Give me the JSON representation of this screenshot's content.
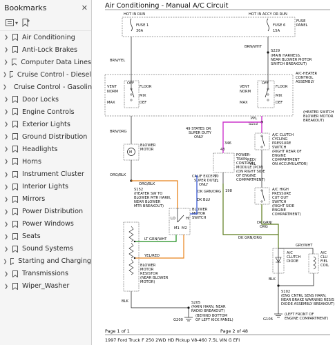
{
  "sidebar": {
    "title": "Bookmarks",
    "close": "✕",
    "bookmarks": [
      "Air Conditioning",
      "Anti-Lock Brakes",
      "Computer Data Lines",
      "Cruise Control - Diesel",
      "Cruise Control - Gasoline",
      "Door Locks",
      "Engine Controls",
      "Exterior Lights",
      "Ground Distribution",
      "Headlights",
      "Horns",
      "Instrument Cluster",
      "Interior Lights",
      "Mirrors",
      "Power Distribution",
      "Power Windows",
      "Seats",
      "Sound Systems",
      "Starting and Charging",
      "Transmissions",
      "Wiper_Washer"
    ]
  },
  "diagram": {
    "title": "Air Conditioning - Manual A/C Circuit",
    "hot_run": "HOT IN RUN",
    "hot_accy": "HOT IN ACCY OR RUN",
    "fuse1": "FUSE 1",
    "fuse1_amp": "30A",
    "fuse6": "FUSE 6",
    "fuse6_amp": "15A",
    "fuse_panel_1": "FUSE",
    "fuse_panel_2": "PANEL",
    "w_brn_yel": "BRN/YEL",
    "w_brn_wht": "BRN/WHT",
    "s229": "S229",
    "s229_n1": "(MAIN HARNESS,",
    "s229_n2": "NEAR BLOWER MOTOR",
    "s229_n3": "SWITCH BREAKOUT)",
    "ach1": "A/C-HEATER",
    "ach2": "CONTROL",
    "ach3": "ASSEMBLY",
    "vent": "VENT",
    "norm": "NORM",
    "max": "MAX",
    "off": "OFF",
    "floor": "FLOOR",
    "mix": "MIX",
    "def": "DEF",
    "ppl": "PPL",
    "s153": "S153",
    "hs1": "(HEATER SWITCH",
    "hs2": "BLOWER MOTOR",
    "hs3": "BREAKOUT)",
    "w_brn_org": "BRN/ORG",
    "states1": "49 STATES OR",
    "states2": "SUPER DUTY",
    "states3": "ONLY",
    "pin346": "346",
    "pin43": "43",
    "pcm1": "POWER-",
    "pcm2": "TRAIN",
    "pcm3": "CONTROL",
    "pcm4": "MODULE (PCM)",
    "pcm5": "(ON RIGHT SIDE",
    "pcm6": "OF ENGINE",
    "pcm7": "COMPARTMENT)",
    "ac_cyc1": "A/C CLUTCH",
    "ac_cyc2": "CYCLING",
    "ac_cyc3": "PRESSURE",
    "ac_cyc4": "SWITCH",
    "ac_cyc5": "(RIGHT REAR OF",
    "ac_cyc6": "ENGINE",
    "ac_cyc7": "COMPARTMENT",
    "ac_cyc8": "ON ACCUMULATOR)",
    "w_red_yel1": "RED/",
    "w_red_yel2": "YEL",
    "blower1": "BLOWER",
    "blower2": "MOTOR",
    "calif1": "CALIF EXCEPT",
    "calif2": "SUPER DUTY",
    "calif3": "ONLY",
    "pin10": "10",
    "pin41": "41",
    "w_dk_grn_org": "DK GRN/ORG",
    "pin198": "198",
    "w_org_blk1": "ORG/BLK",
    "w_org_blk2": "ORG/BLK",
    "s152": "S152",
    "s152_n1": "(HEATER SW TO",
    "s152_n2": "BLOWER MTR HARN,",
    "s152_n3": "NEAR BLOWER",
    "s152_n4": "MTR BREAKOUT)",
    "w_dk_blu": "DK BLU",
    "bms1": "BLOWER",
    "bms2": "MOTOR",
    "bms3": "SWITCH",
    "lo": "LO",
    "hi": "HI",
    "m1": "M1",
    "m2": "M2",
    "achp1": "A/C HIGH",
    "achp2": "PRESSURE",
    "achp3": "CUT OUT",
    "achp4": "SWITCH",
    "achp5": "(RIGHT SIDE",
    "achp6": "ENGINE",
    "achp7": "COMPARTMENT)",
    "w_dk_grn_org2a": "DK GRN/",
    "w_dk_grn_org2b": "ORG",
    "w_dk_grn_org3": "DK GRN/ORG",
    "w_lt_grn_wht": "LT GRN/WHT",
    "w_gry_wht": "GRY/WHT",
    "acc1": "A/C",
    "acc2": "CLUTCH",
    "acc3": "DIODE",
    "acf1": "A/C",
    "acf2": "CLU",
    "acf3": "FIEL",
    "acf4": "COIL",
    "w_yel_red": "YEL/RED",
    "bmr1": "BLOWER",
    "bmr2": "MOTOR",
    "bmr3": "RESISTOR",
    "bmr4": "(NEAR BLOWER",
    "bmr5": "MOTOR)",
    "blk": "BLK",
    "s102": "S102",
    "s102_n1": "(ENG CNTRL SENS HARN,",
    "s102_n2": "NEAR BRAKE WARNING RESIS",
    "s102_n3": "DIODE ASSEMBLY BREAKOUT)",
    "s205": "S205",
    "s205_n1": "(MAIN HARN, NEAR",
    "s205_n2": "RADIO BREAKOUT)",
    "g200": "G200",
    "g200_n1": "(BEHIND BOTTOM",
    "g200_n2": "OF LEFT KICK PANEL)",
    "g106": "G106",
    "g106_n1": "(LEFT FRONT OF",
    "g106_n2": "ENGINE COMPARTMENT)",
    "page_left": "Page 1 of 1",
    "page_right": "Page 2 of 48",
    "vehicle": "1997 Ford Truck F 250 2WD HD Pickup V8-460 7.5L VIN G EFI"
  },
  "colors": {
    "wire_yellow": "#e6c800",
    "wire_orange": "#e8821a",
    "wire_green": "#5a7a1a",
    "wire_purple": "#cc33cc",
    "wire_darkgreen": "#1a8c1a",
    "wire_blue": "#2b4ed0",
    "wire_black": "#111111"
  }
}
